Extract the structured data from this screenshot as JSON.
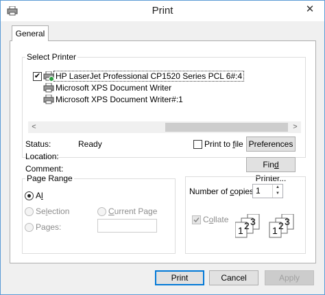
{
  "window": {
    "title": "Print",
    "close_glyph": "✕"
  },
  "tabs": [
    {
      "label": "General"
    }
  ],
  "select_printer": {
    "legend": "Select Printer",
    "printers": [
      {
        "name": "HP LaserJet Professional CP1520 Series PCL 6#:4",
        "selected": true,
        "checked": true
      },
      {
        "name": "Microsoft XPS Document Writer",
        "selected": false
      },
      {
        "name": "Microsoft XPS Document Writer#:1",
        "selected": false
      }
    ],
    "scroll_left": "<",
    "scroll_right": ">",
    "status_label": "Status:",
    "status_value": "Ready",
    "location_label": "Location:",
    "comment_label": "Comment:",
    "print_to_file_pre": "Print to ",
    "print_to_file_key": "f",
    "print_to_file_post": "ile",
    "preferences_label": "Preferences",
    "find_printer_pre": "Fin",
    "find_printer_key": "d",
    "find_printer_post": " Printer..."
  },
  "page_range": {
    "legend": "Page Range",
    "all_key": "l",
    "all_pre": "A",
    "all_post": "",
    "selection_pre": "Se",
    "selection_key": "l",
    "selection_post": "ection",
    "current_pre": "",
    "current_key": "C",
    "current_post": "urrent Page",
    "pages_pre": "Pa",
    "pages_key": "g",
    "pages_post": "es:",
    "selected": "all"
  },
  "copies": {
    "label_pre": "Number of ",
    "label_key": "c",
    "label_post": "opies:",
    "value": "1",
    "collate_pre": "C",
    "collate_key": "o",
    "collate_post": "llate",
    "collate_checked": true,
    "collate_disabled": true,
    "set1": [
      "1",
      "2",
      "3"
    ],
    "set2": [
      "1",
      "2",
      "3"
    ]
  },
  "buttons": {
    "print": "Print",
    "cancel": "Cancel",
    "apply": "Apply"
  }
}
